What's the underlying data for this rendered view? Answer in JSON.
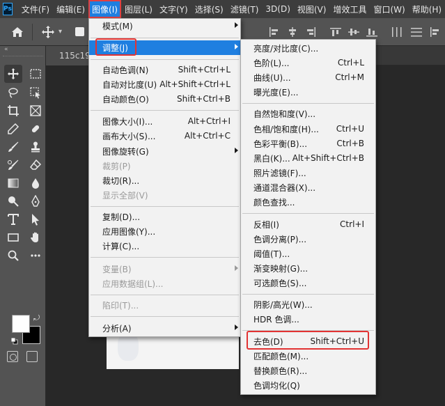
{
  "menubar": {
    "logo": "Ps",
    "items": [
      "文件(F)",
      "编辑(E)",
      "图像(I)",
      "图层(L)",
      "文字(Y)",
      "选择(S)",
      "滤镜(T)",
      "3D(D)",
      "视图(V)",
      "增效工具",
      "窗口(W)",
      "帮助(H)"
    ]
  },
  "document": {
    "tab_title": "115c199"
  },
  "image_menu": {
    "items": [
      {
        "label": "模式(M)",
        "shortcut": "",
        "submenu": true,
        "disabled": false
      },
      {
        "label": "调整(J)",
        "shortcut": "",
        "submenu": true,
        "disabled": false,
        "highlighted": true
      },
      {
        "label": "自动色调(N)",
        "shortcut": "Shift+Ctrl+L"
      },
      {
        "label": "自动对比度(U)",
        "shortcut": "Alt+Shift+Ctrl+L"
      },
      {
        "label": "自动颜色(O)",
        "shortcut": "Shift+Ctrl+B"
      },
      {
        "label": "图像大小(I)...",
        "shortcut": "Alt+Ctrl+I"
      },
      {
        "label": "画布大小(S)...",
        "shortcut": "Alt+Ctrl+C"
      },
      {
        "label": "图像旋转(G)",
        "shortcut": "",
        "submenu": true
      },
      {
        "label": "裁剪(P)",
        "shortcut": "",
        "disabled": true
      },
      {
        "label": "裁切(R)...",
        "shortcut": ""
      },
      {
        "label": "显示全部(V)",
        "shortcut": "",
        "disabled": true
      },
      {
        "label": "复制(D)...",
        "shortcut": ""
      },
      {
        "label": "应用图像(Y)...",
        "shortcut": ""
      },
      {
        "label": "计算(C)...",
        "shortcut": ""
      },
      {
        "label": "变量(B)",
        "shortcut": "",
        "submenu": true,
        "disabled": true
      },
      {
        "label": "应用数据组(L)...",
        "shortcut": "",
        "disabled": true
      },
      {
        "label": "陷印(T)...",
        "shortcut": "",
        "disabled": true
      },
      {
        "label": "分析(A)",
        "shortcut": "",
        "submenu": true
      }
    ]
  },
  "adjust_menu": {
    "items": [
      {
        "label": "亮度/对比度(C)...",
        "shortcut": ""
      },
      {
        "label": "色阶(L)...",
        "shortcut": "Ctrl+L"
      },
      {
        "label": "曲线(U)...",
        "shortcut": "Ctrl+M"
      },
      {
        "label": "曝光度(E)...",
        "shortcut": ""
      },
      {
        "label": "自然饱和度(V)...",
        "shortcut": ""
      },
      {
        "label": "色相/饱和度(H)...",
        "shortcut": "Ctrl+U"
      },
      {
        "label": "色彩平衡(B)...",
        "shortcut": "Ctrl+B"
      },
      {
        "label": "黑白(K)...",
        "shortcut": "Alt+Shift+Ctrl+B"
      },
      {
        "label": "照片滤镜(F)...",
        "shortcut": ""
      },
      {
        "label": "通道混合器(X)...",
        "shortcut": ""
      },
      {
        "label": "颜色查找...",
        "shortcut": ""
      },
      {
        "label": "反相(I)",
        "shortcut": "Ctrl+I"
      },
      {
        "label": "色调分离(P)...",
        "shortcut": ""
      },
      {
        "label": "阈值(T)...",
        "shortcut": ""
      },
      {
        "label": "渐变映射(G)...",
        "shortcut": ""
      },
      {
        "label": "可选颜色(S)...",
        "shortcut": ""
      },
      {
        "label": "阴影/高光(W)...",
        "shortcut": ""
      },
      {
        "label": "HDR 色调...",
        "shortcut": ""
      },
      {
        "label": "去色(D)",
        "shortcut": "Shift+Ctrl+U"
      },
      {
        "label": "匹配颜色(M)...",
        "shortcut": ""
      },
      {
        "label": "替换颜色(R)...",
        "shortcut": ""
      },
      {
        "label": "色调均化(Q)",
        "shortcut": ""
      }
    ]
  },
  "colors": {
    "highlight": "#1f7fe0",
    "annotation_red": "#e23333",
    "foreground": "#ffffff",
    "background": "#000000"
  },
  "icons": [
    "home-icon",
    "move-icon",
    "marquee-icon",
    "lasso-icon",
    "crop-icon",
    "eyedropper-icon",
    "brush-icon",
    "stamp-icon",
    "eraser-icon",
    "gradient-icon",
    "dodge-icon",
    "pen-icon",
    "type-icon",
    "select-arrow-icon",
    "rectangle-icon",
    "hand-icon",
    "zoom-icon"
  ]
}
